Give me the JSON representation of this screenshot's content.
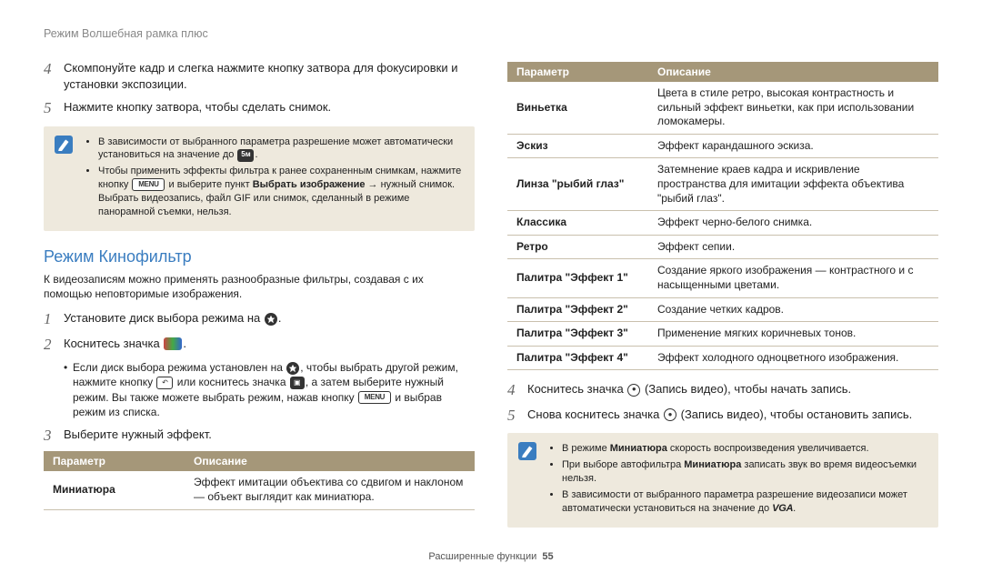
{
  "header": "Режим Волшебная рамка плюс",
  "left": {
    "steps_a": [
      {
        "n": "4",
        "t": "Скомпонуйте кадр и слегка нажмите кнопку затвора для фокусировки и установки экспозиции."
      },
      {
        "n": "5",
        "t": "Нажмите кнопку затвора, чтобы сделать снимок."
      }
    ],
    "note1_items": {
      "i0a": "В зависимости от выбранного параметра разрешение может автоматически установиться на значение до ",
      "i0b": ".",
      "i1a": "Чтобы применить эффекты фильтра к ранее сохраненным снимкам, нажмите кнопку ",
      "i1b": " и выберите пункт ",
      "i1c": "Выбрать изображение",
      "i1d": " → нужный снимок. Выбрать видеозапись, файл GIF или снимок, сделанный в режиме панорамной съемки, нельзя."
    },
    "section_heading": "Режим Кинофильтр",
    "section_intro": "К видеозаписям можно применять разнообразные фильтры, создавая с их помощью неповторимые изображения.",
    "step1_a": "Установите диск выбора режима на ",
    "step1_b": ".",
    "step2_a": "Коснитесь значка ",
    "step2_b": ".",
    "sub_a": "Если диск выбора режима установлен на ",
    "sub_b": ", чтобы выбрать другой режим, нажмите кнопку ",
    "sub_c": " или коснитесь значка ",
    "sub_d": ", а затем выберите нужный режим. Вы также можете выбрать режим, нажав кнопку ",
    "sub_e": " и выбрав режим из списка.",
    "step3": "Выберите нужный эффект.",
    "table_hdr_param": "Параметр",
    "table_hdr_desc": "Описание",
    "table_row_param": "Миниатюра",
    "table_row_desc": "Эффект имитации объектива со сдвигом и наклоном — объект выглядит как миниатюра."
  },
  "right": {
    "table_hdr_param": "Параметр",
    "table_hdr_desc": "Описание",
    "rows": [
      {
        "p": "Виньетка",
        "d": "Цвета в стиле ретро, высокая контрастность и сильный эффект виньетки, как при использовании ломокамеры."
      },
      {
        "p": "Эскиз",
        "d": "Эффект карандашного эскиза."
      },
      {
        "p": "Линза \"рыбий глаз\"",
        "d": "Затемнение краев кадра и искривление пространства для имитации эффекта объектива \"рыбий глаз\"."
      },
      {
        "p": "Классика",
        "d": "Эффект черно-белого снимка."
      },
      {
        "p": "Ретро",
        "d": "Эффект сепии."
      },
      {
        "p": "Палитра \"Эффект 1\"",
        "d": "Создание яркого изображения — контрастного и с насыщенными цветами."
      },
      {
        "p": "Палитра \"Эффект 2\"",
        "d": "Создание четких кадров."
      },
      {
        "p": "Палитра \"Эффект 3\"",
        "d": "Применение мягких коричневых тонов."
      },
      {
        "p": "Палитра \"Эффект 4\"",
        "d": "Эффект холодного одноцветного изображения."
      }
    ],
    "step4_a": "Коснитесь значка ",
    "step4_b": " (Запись видео), чтобы начать запись.",
    "step5_a": "Снова коснитесь значка ",
    "step5_b": " (Запись видео), чтобы остановить запись.",
    "note2_items": {
      "i0a": "В режиме ",
      "i0b": "Миниатюра",
      "i0c": " скорость воспроизведения увеличивается.",
      "i1a": "При выборе автофильтра ",
      "i1b": "Миниатюра",
      "i1c": " записать звук во время видеосъемки нельзя.",
      "i2a": "В зависимости от выбранного параметра разрешение видеозаписи может автоматически установиться на значение до ",
      "i2b": "."
    }
  },
  "footer": {
    "label": "Расширенные функции",
    "page": "55"
  },
  "icons": {
    "menu": "MENU",
    "s": "S",
    "vga": "VGA"
  }
}
